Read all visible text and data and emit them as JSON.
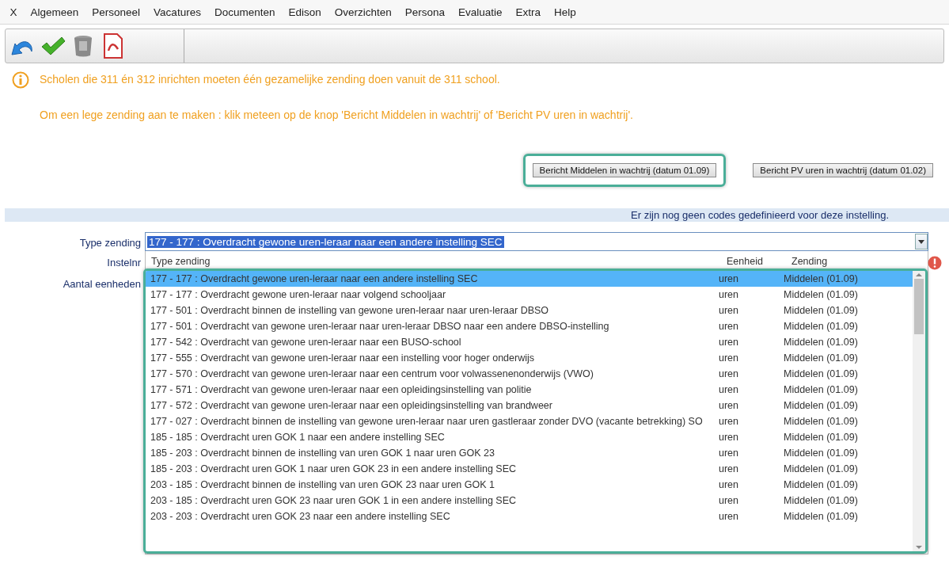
{
  "menu": [
    "X",
    "Algemeen",
    "Personeel",
    "Vacatures",
    "Documenten",
    "Edison",
    "Overzichten",
    "Persona",
    "Evaluatie",
    "Extra",
    "Help"
  ],
  "info": {
    "lines": [
      "Scholen die 311 én 312 inrichten moeten één gezamelijke zending doen vanuit de 311 school.",
      "Om een lege zending aan te maken : klik meteen op de knop 'Bericht Middelen in wachtrij' of 'Bericht PV uren in wachtrij'."
    ]
  },
  "buttons": [
    {
      "label": "Bericht Middelen in wachtrij (datum 01.09)",
      "highlighted": true
    },
    {
      "label": "Bericht PV uren in wachtrij (datum 01.02)",
      "highlighted": false
    }
  ],
  "band_text": "Er zijn nog geen codes gedefinieerd voor deze instelling.",
  "form": {
    "labels": [
      "Type zending",
      "Instelnr",
      "Aantal eenheden"
    ],
    "value": "177 - 177 : Overdracht gewone uren-leraar naar een andere instelling SEC"
  },
  "dropdown": {
    "columns": [
      "Type zending",
      "Eenheid",
      "Zending"
    ],
    "rows": [
      {
        "type": "177 - 177 : Overdracht gewone uren-leraar naar een andere instelling SEC",
        "unit": "uren",
        "zending": "Middelen (01.09)",
        "selected": true
      },
      {
        "type": "177 - 177 : Overdracht gewone uren-leraar naar volgend schooljaar",
        "unit": "uren",
        "zending": "Middelen (01.09)",
        "selected": false
      },
      {
        "type": "177 - 501 : Overdracht binnen de instelling van gewone uren-leraar naar uren-leraar DBSO",
        "unit": "uren",
        "zending": "Middelen (01.09)",
        "selected": false
      },
      {
        "type": "177 - 501 : Overdracht van gewone uren-leraar naar uren-leraar DBSO naar een andere DBSO-instelling",
        "unit": "uren",
        "zending": "Middelen (01.09)",
        "selected": false
      },
      {
        "type": "177 - 542 : Overdracht van gewone uren-leraar naar een BUSO-school",
        "unit": "uren",
        "zending": "Middelen (01.09)",
        "selected": false
      },
      {
        "type": "177 - 555 : Overdracht van gewone uren-leraar naar een instelling voor hoger onderwijs",
        "unit": "uren",
        "zending": "Middelen (01.09)",
        "selected": false
      },
      {
        "type": "177 - 570 : Overdracht van gewone uren-leraar naar een centrum voor volwassenenonderwijs (VWO)",
        "unit": "uren",
        "zending": "Middelen (01.09)",
        "selected": false
      },
      {
        "type": "177 - 571 : Overdracht van gewone uren-leraar naar een opleidingsinstelling van politie",
        "unit": "uren",
        "zending": "Middelen (01.09)",
        "selected": false
      },
      {
        "type": "177 - 572 : Overdracht van gewone uren-leraar naar een opleidingsinstelling van brandweer",
        "unit": "uren",
        "zending": "Middelen (01.09)",
        "selected": false
      },
      {
        "type": "177 - 027 : Overdracht binnen de instelling van gewone uren-leraar naar uren gastleraar zonder DVO (vacante betrekking) SO",
        "unit": "uren",
        "zending": "Middelen (01.09)",
        "selected": false
      },
      {
        "type": "185 - 185 : Overdracht uren GOK 1 naar een andere instelling SEC",
        "unit": "uren",
        "zending": "Middelen (01.09)",
        "selected": false
      },
      {
        "type": "185 - 203 : Overdracht binnen de instelling van uren GOK 1 naar uren GOK 23",
        "unit": "uren",
        "zending": "Middelen (01.09)",
        "selected": false
      },
      {
        "type": "185 - 203 : Overdracht uren GOK 1 naar uren GOK 23 in een andere instelling SEC",
        "unit": "uren",
        "zending": "Middelen (01.09)",
        "selected": false
      },
      {
        "type": "203 - 185 : Overdracht binnen de instelling van uren GOK 23 naar uren GOK 1",
        "unit": "uren",
        "zending": "Middelen (01.09)",
        "selected": false
      },
      {
        "type": "203 - 185 : Overdracht uren GOK 23 naar uren GOK 1 in een andere instelling SEC",
        "unit": "uren",
        "zending": "Middelen (01.09)",
        "selected": false
      },
      {
        "type": "203 - 203 : Overdracht uren GOK 23 naar een andere instelling SEC",
        "unit": "uren",
        "zending": "Middelen (01.09)",
        "selected": false
      }
    ]
  }
}
